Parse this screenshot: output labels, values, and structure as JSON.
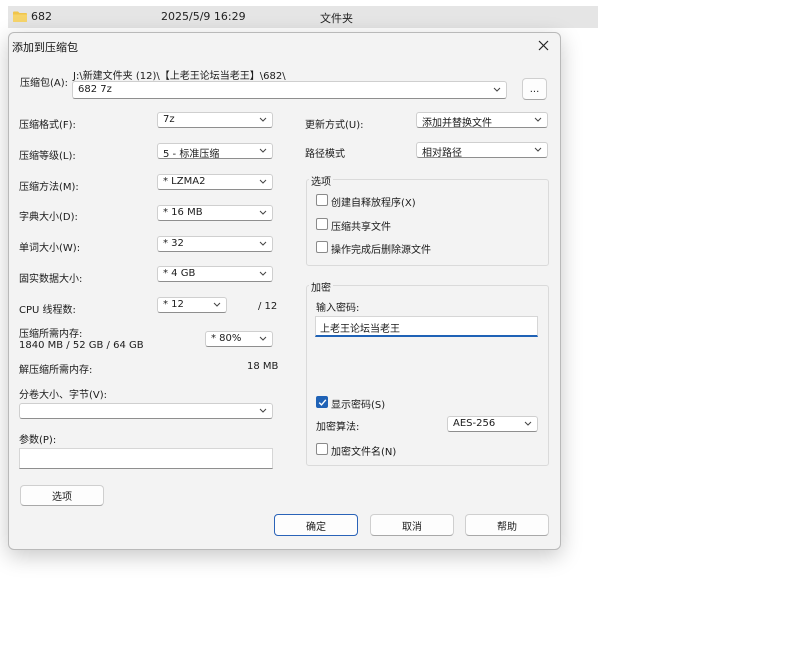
{
  "explorer": {
    "name": "682",
    "date": "2025/5/9 16:29",
    "type": "文件夹"
  },
  "dialog": {
    "title": "添加到压缩包",
    "archive": {
      "label": "压缩包(A):",
      "path": "J:\\新建文件夹 (12)\\【上老王论坛当老王】\\682\\",
      "filename": "682 7z",
      "browse_label": "..."
    },
    "left": {
      "format_label": "压缩格式(F):",
      "format_value": "7z",
      "level_label": "压缩等级(L):",
      "level_value": "5 - 标准压缩",
      "method_label": "压缩方法(M):",
      "method_value": "* LZMA2",
      "dict_label": "字典大小(D):",
      "dict_value": "* 16 MB",
      "word_label": "单词大小(W):",
      "word_value": "* 32",
      "solid_label": "固实数据大小:",
      "solid_value": "* 4 GB",
      "cpu_label": "CPU 线程数:",
      "cpu_value": "* 12",
      "cpu_total": "/ 12",
      "mem_label": "压缩所需内存:",
      "mem_detail": "1840 MB / 52 GB / 64 GB",
      "mem_percent": "* 80%",
      "decomp_label": "解压缩所需内存:",
      "decomp_value": "18 MB",
      "split_label": "分卷大小、字节(V):",
      "split_value": "",
      "params_label": "参数(P):",
      "params_value": "",
      "options_button": "选项"
    },
    "right": {
      "update_label": "更新方式(U):",
      "update_value": "添加并替换文件",
      "path_label": "路径模式",
      "path_value": "相对路径",
      "options_group": "选项",
      "opt_sfx": "创建自释放程序(X)",
      "opt_shared": "压缩共享文件",
      "opt_delete": "操作完成后删除源文件",
      "encrypt_group": "加密",
      "password_label": "输入密码:",
      "password_value": "上老王论坛当老王",
      "show_password": "显示密码(S)",
      "show_password_checked": true,
      "algo_label": "加密算法:",
      "algo_value": "AES-256",
      "encrypt_names": "加密文件名(N)"
    },
    "buttons": {
      "ok": "确定",
      "cancel": "取消",
      "help": "帮助"
    }
  },
  "colors": {
    "accent": "#1f62b6",
    "folder": "#f0c54b"
  }
}
